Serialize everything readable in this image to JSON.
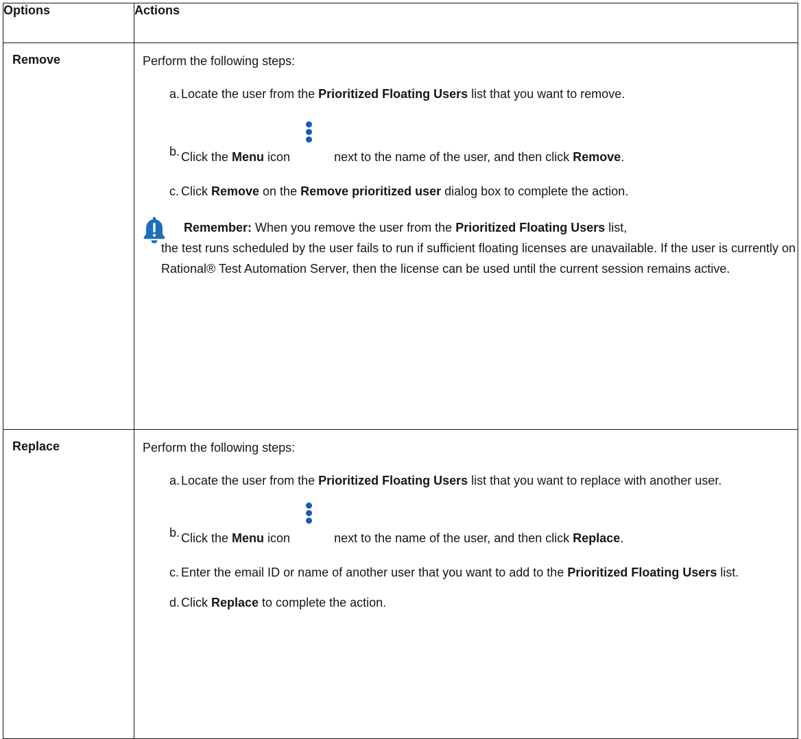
{
  "header": {
    "options": "Options",
    "actions": "Actions"
  },
  "icons": {
    "menu": "overflow-menu-vertical-icon",
    "note": "bell-icon",
    "accent": "#1b5ab8",
    "note_color": "#1d6fb8"
  },
  "remove": {
    "option": "Remove",
    "intro": "Perform the following steps:",
    "steps": [
      {
        "label": "a.",
        "t1": "Locate the user from the ",
        "b1": "Prioritized Floating Users",
        "t2": " list that you want to remove."
      },
      {
        "label": "b.",
        "t1": "Click the ",
        "b1": "Menu",
        "t2": " icon",
        "t3": "next to the name of the user, and then click ",
        "b2": "Remove",
        "t4": "."
      },
      {
        "label": "c.",
        "t1": "Click ",
        "b1": "Remove",
        "t2": " on the ",
        "b2": "Remove prioritized user",
        "t3": " dialog box to complete the action."
      }
    ],
    "note": {
      "label": "Remember:",
      "t1": " When you remove the user from the ",
      "b1": "Prioritized Floating Users",
      "t2": " list,",
      "t3": "the test runs scheduled by the user fails to run if sufficient floating licenses are unavailable. If the user is currently on Rational® Test Automation Server, then the license can be used until the current session remains active."
    }
  },
  "replace": {
    "option": "Replace",
    "intro": "Perform the following steps:",
    "steps": [
      {
        "label": "a.",
        "t1": "Locate the user from the ",
        "b1": "Prioritized Floating Users",
        "t2": " list that you want to replace with another user."
      },
      {
        "label": "b.",
        "t1": "Click the ",
        "b1": "Menu",
        "t2": " icon",
        "t3": "next to the name of the user, and then click ",
        "b2": "Replace",
        "t4": "."
      },
      {
        "label": "c.",
        "t1": "Enter the email ID or name of another user that you want to add to the ",
        "b1": "Prioritized Floating Users",
        "t2": " list."
      },
      {
        "label": "d.",
        "t1": "Click ",
        "b1": "Replace",
        "t2": " to complete the action."
      }
    ]
  }
}
